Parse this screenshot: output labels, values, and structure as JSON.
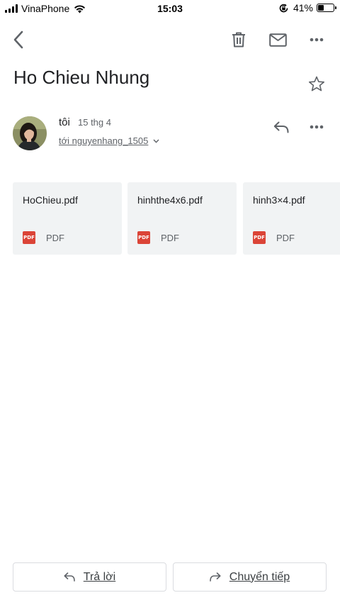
{
  "status_bar": {
    "carrier": "VinaPhone",
    "time": "15:03",
    "battery_percent": "41%",
    "battery_level": 0.41,
    "icons": [
      "signal-icon",
      "wifi-icon",
      "orientation-lock-icon",
      "battery-icon"
    ]
  },
  "toolbar": {
    "icons": [
      "back-icon",
      "delete-icon",
      "mail-icon",
      "more-icon"
    ]
  },
  "email": {
    "subject": "Ho Chieu Nhung",
    "sender": "tôi",
    "date": "15 thg 4",
    "recipient": "tới nguyenhang_1505",
    "icons": [
      "star-icon",
      "reply-icon",
      "more-icon",
      "chevron-down-icon"
    ]
  },
  "attachments": [
    {
      "name": "HoChieu.pdf",
      "badge": "PDF",
      "type": "PDF"
    },
    {
      "name": "hinhthe4x6.pdf",
      "badge": "PDF",
      "type": "PDF"
    },
    {
      "name": "hinh3×4.pdf",
      "badge": "PDF",
      "type": "PDF"
    }
  ],
  "actions": {
    "reply_label": "Trả lời",
    "forward_label": "Chuyển tiếp"
  },
  "colors": {
    "pdf_red": "#db4437",
    "card_bg": "#f1f3f4",
    "icon_gray": "#5f6368"
  }
}
